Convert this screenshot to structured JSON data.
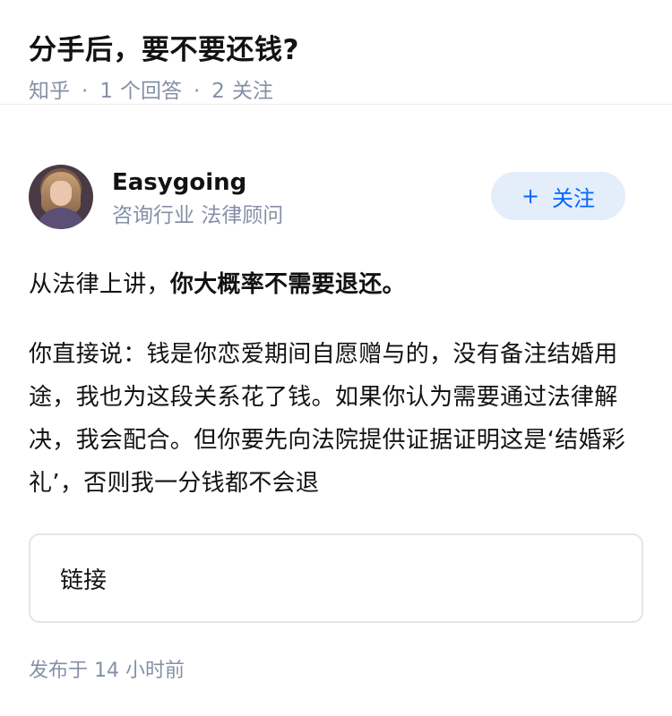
{
  "question": {
    "title": "分手后，要不要还钱?",
    "meta": {
      "source": "知乎",
      "answer_count": "1",
      "answer_label": "个回答",
      "follow_count": "2",
      "follow_label": "关注"
    }
  },
  "author": {
    "name": "Easygoing",
    "headline": "咨询行业 法律顾问",
    "follow_button": {
      "icon": "+",
      "label": "关注"
    }
  },
  "answer": {
    "para1_prefix": "从法律上讲，",
    "para1_bold": "你大概率不需要退还。",
    "para2": "你直接说：钱是你恋爱期间自愿赠与的，没有备注结婚用途，我也为这段关系花了钱。如果你认为需要通过法律解决，我会配合。但你要先向法院提供证据证明这是‘结婚彩礼’，否则我一分钱都不会退"
  },
  "link_card": {
    "label": "链接"
  },
  "published": "发布于  14 小时前",
  "colors": {
    "accent": "#0066ff",
    "follow_bg": "#e4eefa",
    "meta_gray": "#8590a6"
  }
}
